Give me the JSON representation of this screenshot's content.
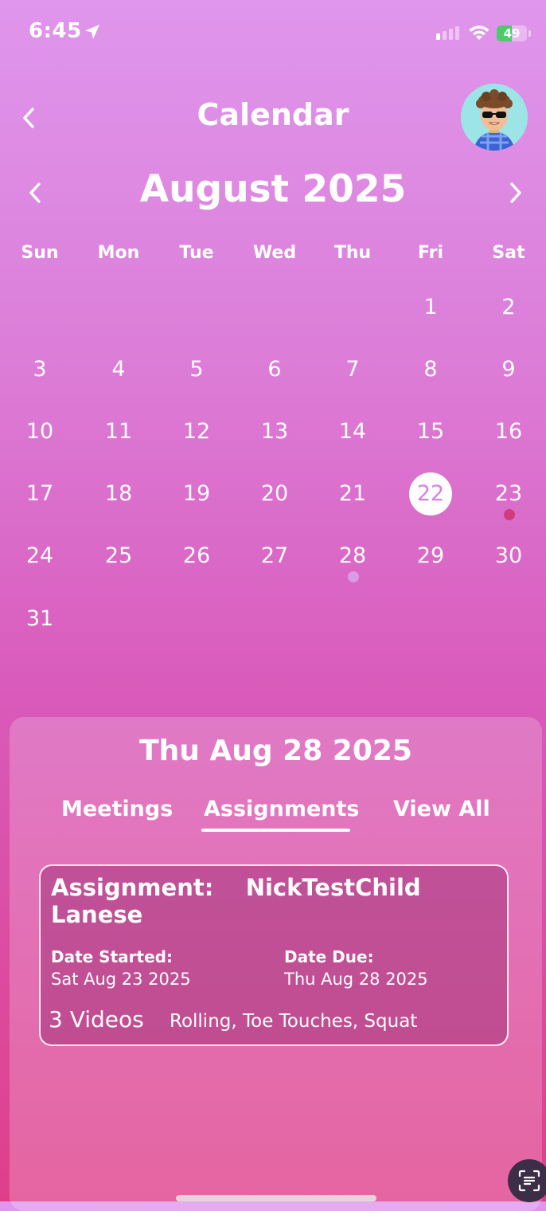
{
  "status_bar": {
    "time": "6:45",
    "battery": "49",
    "battery_level": 0.49
  },
  "header": {
    "title": "Calendar",
    "back_icon": "chevron-left-icon",
    "avatar": "avatar"
  },
  "month": {
    "title": "August 2025",
    "prev_icon": "chevron-left-icon",
    "next_icon": "chevron-right-icon"
  },
  "weekdays": [
    "Sun",
    "Mon",
    "Tue",
    "Wed",
    "Thu",
    "Fri",
    "Sat"
  ],
  "days": [
    "1",
    "2",
    "3",
    "4",
    "5",
    "6",
    "7",
    "8",
    "9",
    "10",
    "11",
    "12",
    "13",
    "14",
    "15",
    "16",
    "17",
    "18",
    "19",
    "20",
    "21",
    "22",
    "23",
    "24",
    "25",
    "26",
    "27",
    "28",
    "29",
    "30",
    "31"
  ],
  "selected_day": "22",
  "event_dots": [
    {
      "day": "23",
      "color": "#d23a7d"
    },
    {
      "day": "28",
      "color": "#d99ae8"
    }
  ],
  "panel": {
    "date": "Thu Aug 28 2025",
    "tabs": [
      "Meetings",
      "Assignments",
      "View All"
    ],
    "active_tab": "Assignments"
  },
  "assignment": {
    "title": "Assignment:    NickTestChild\nLanese",
    "started_label": "Date Started:",
    "started_value": "Sat Aug 23 2025",
    "due_label": "Date Due:",
    "due_value": "Thu Aug 28 2025",
    "video_count": "3 Videos",
    "videos": "Rolling, Toe Touches, Squat"
  },
  "colors": {
    "selected_text": "#d582e0",
    "battery_fill": "#4fc96b"
  }
}
